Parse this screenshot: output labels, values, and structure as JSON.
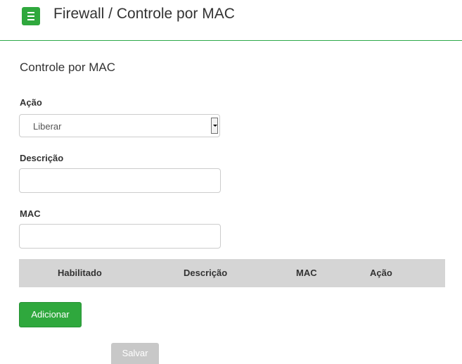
{
  "header": {
    "title": "Firewall / Controle por MAC"
  },
  "section": {
    "title": "Controle por MAC"
  },
  "form": {
    "action": {
      "label": "Ação",
      "selected": "Liberar"
    },
    "description": {
      "label": "Descrição",
      "value": ""
    },
    "mac": {
      "label": "MAC",
      "value": ""
    }
  },
  "table": {
    "columns": [
      "Habilitado",
      "Descrição",
      "MAC",
      "Ação"
    ]
  },
  "buttons": {
    "add": "Adicionar",
    "save": "Salvar"
  },
  "colors": {
    "accent": "#2fa83d",
    "header_rule": "#2daa4a",
    "table_header_bg": "#d5d5d5",
    "save_bg": "#c8c8c8"
  },
  "icons": {
    "menu": "hamburger-menu-icon"
  }
}
